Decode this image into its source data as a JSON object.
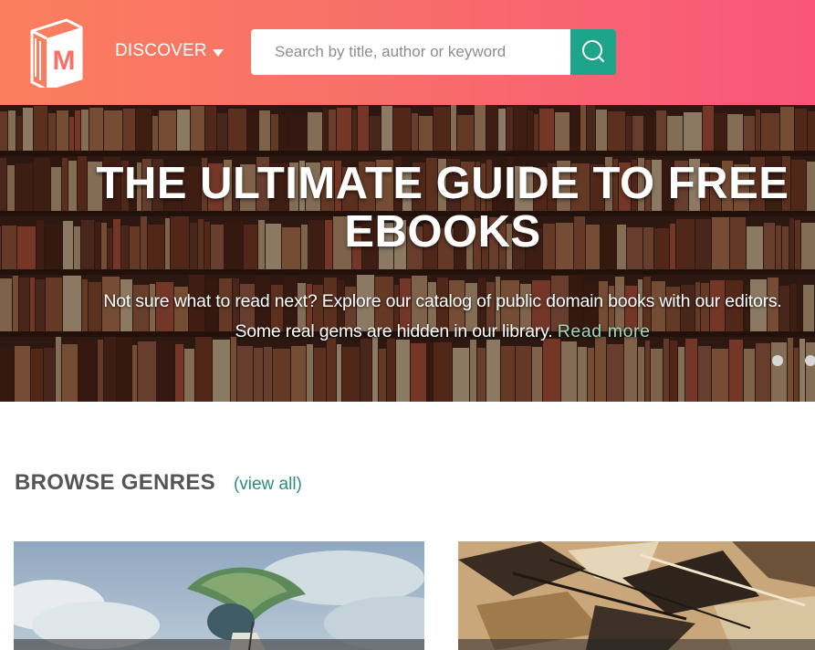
{
  "header": {
    "logo_letter": "M",
    "nav": {
      "discover_label": "DISCOVER"
    },
    "search": {
      "placeholder": "Search by title, author or keyword",
      "value": ""
    },
    "colors": {
      "gradient_start": "#fb7f5e",
      "gradient_end": "#f9567a",
      "search_button": "#1ea48a"
    }
  },
  "hero": {
    "title": "THE ULTIMATE GUIDE TO FREE EBOOKS",
    "text": "Not sure what to read next? Explore our catalog of public domain books with our editors. Some real gems are hidden in our library.",
    "link_label": "Read more",
    "slides": 2
  },
  "genres": {
    "title": "BROWSE GENRES",
    "view_all": "(view all)",
    "cards": [
      {
        "name": "genre-card-1"
      },
      {
        "name": "genre-card-2"
      }
    ]
  }
}
